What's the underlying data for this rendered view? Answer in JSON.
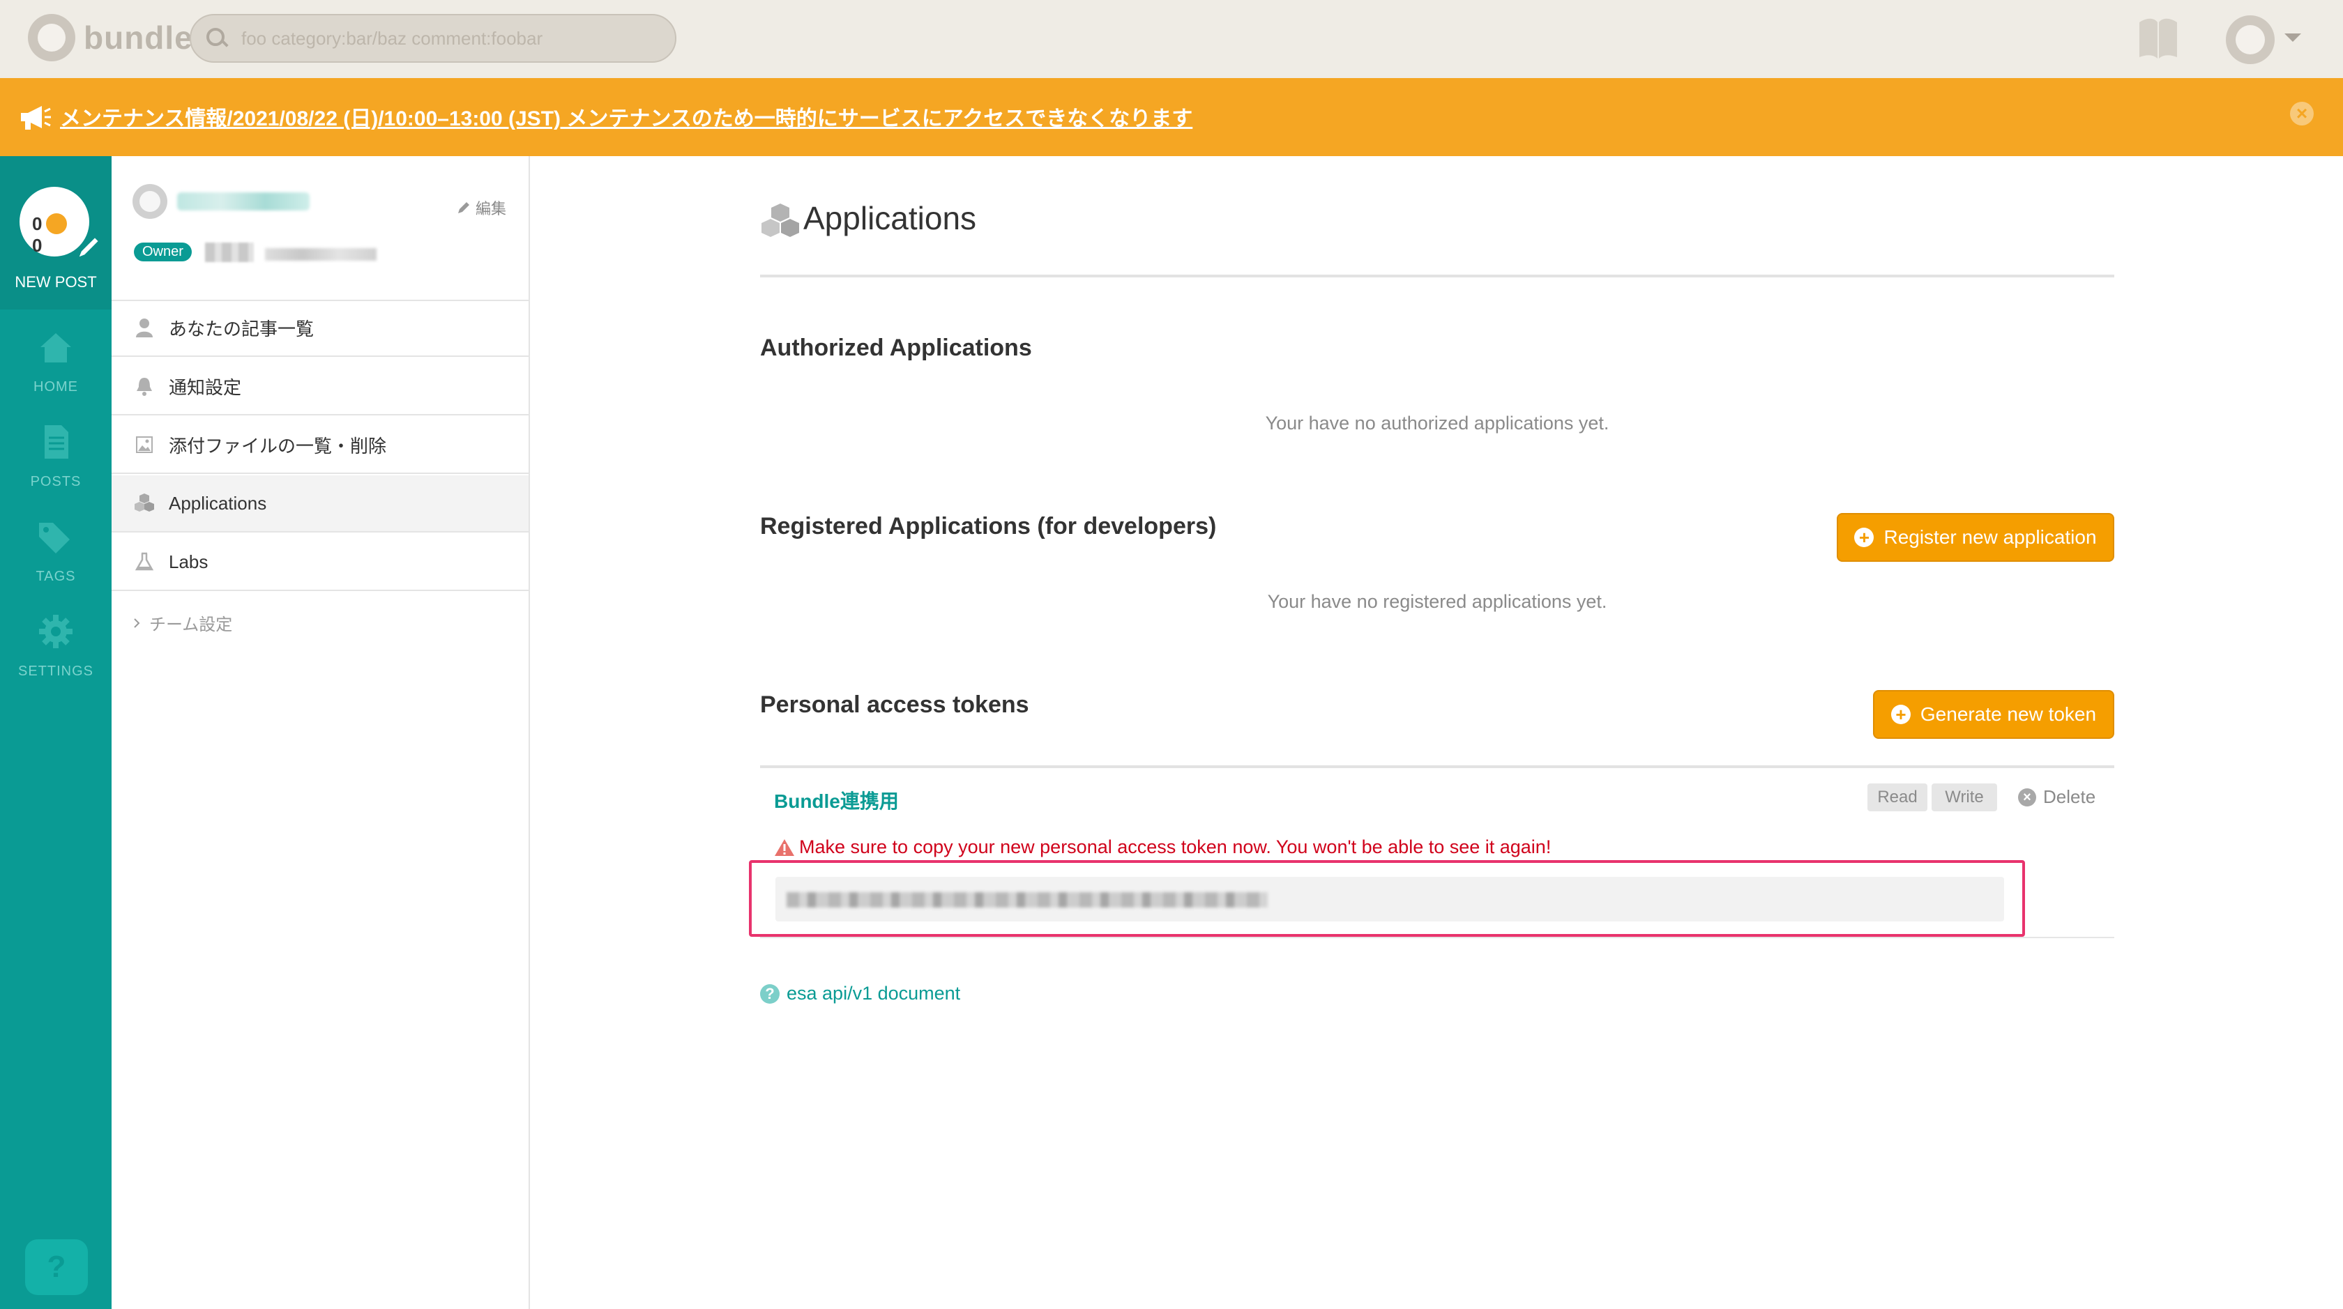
{
  "topbar": {
    "app_name": "bundle",
    "search_placeholder": "foo category:bar/baz comment:foobar"
  },
  "banner": {
    "text": "メンテナンス情報/2021/08/22 (日)/10:00–13:00 (JST) メンテナンスのため一時的にサービスにアクセスできなくなります"
  },
  "rail": {
    "new_post": "NEW POST",
    "home": "HOME",
    "posts": "POSTS",
    "tags": "TAGS",
    "settings": "SETTINGS",
    "help": "?"
  },
  "sidebar": {
    "edit_label": "編集",
    "owner_badge": "Owner",
    "items": [
      {
        "label": "あなたの記事一覧",
        "icon": "user-icon"
      },
      {
        "label": "通知設定",
        "icon": "bell-icon"
      },
      {
        "label": "添付ファイルの一覧・削除",
        "icon": "image-icon"
      },
      {
        "label": "Applications",
        "icon": "cubes-icon"
      },
      {
        "label": "Labs",
        "icon": "flask-icon"
      }
    ],
    "team_settings": "チーム設定"
  },
  "main": {
    "title": "Applications",
    "authorized": {
      "title": "Authorized Applications",
      "empty": "Your have no authorized applications yet."
    },
    "registered": {
      "title": "Registered Applications (for developers)",
      "button": "Register new application",
      "empty": "Your have no registered applications yet."
    },
    "tokens": {
      "title": "Personal access tokens",
      "button": "Generate new token",
      "token_name": "Bundle連携用",
      "scopes": [
        "Read",
        "Write"
      ],
      "delete": "Delete",
      "warning": "Make sure to copy your new personal access token now. You won't be able to see it again!"
    },
    "doc_link": "esa api/v1 document"
  },
  "colors": {
    "accent": "#0a9b94",
    "banner": "#f5a623",
    "button": "#f59e00",
    "warning": "#d0021b",
    "highlight": "#e8336d"
  }
}
